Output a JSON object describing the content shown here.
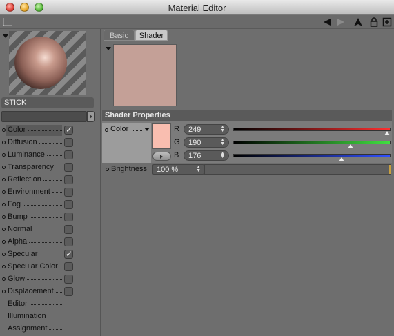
{
  "window": {
    "title": "Material Editor"
  },
  "toolbar": {
    "icons": [
      "back-arrow-icon",
      "forward-arrow-icon",
      "up-arrow-icon",
      "lock-icon",
      "new-window-icon"
    ]
  },
  "material": {
    "name": "STICK",
    "name_field_value": ""
  },
  "channels": [
    {
      "label": "Color",
      "checked": true,
      "selected": true,
      "has_bullet": true,
      "has_checkbox": true
    },
    {
      "label": "Diffusion",
      "checked": false,
      "selected": false,
      "has_bullet": true,
      "has_checkbox": true
    },
    {
      "label": "Luminance",
      "checked": false,
      "selected": false,
      "has_bullet": true,
      "has_checkbox": true
    },
    {
      "label": "Transparency",
      "checked": false,
      "selected": false,
      "has_bullet": true,
      "has_checkbox": true
    },
    {
      "label": "Reflection",
      "checked": false,
      "selected": false,
      "has_bullet": true,
      "has_checkbox": true
    },
    {
      "label": "Environment",
      "checked": false,
      "selected": false,
      "has_bullet": true,
      "has_checkbox": true
    },
    {
      "label": "Fog",
      "checked": false,
      "selected": false,
      "has_bullet": true,
      "has_checkbox": true
    },
    {
      "label": "Bump",
      "checked": false,
      "selected": false,
      "has_bullet": true,
      "has_checkbox": true
    },
    {
      "label": "Normal",
      "checked": false,
      "selected": false,
      "has_bullet": true,
      "has_checkbox": true
    },
    {
      "label": "Alpha",
      "checked": false,
      "selected": false,
      "has_bullet": true,
      "has_checkbox": true
    },
    {
      "label": "Specular",
      "checked": true,
      "selected": false,
      "has_bullet": true,
      "has_checkbox": true
    },
    {
      "label": "Specular Color",
      "checked": false,
      "selected": false,
      "has_bullet": true,
      "has_checkbox": true
    },
    {
      "label": "Glow",
      "checked": false,
      "selected": false,
      "has_bullet": true,
      "has_checkbox": true
    },
    {
      "label": "Displacement",
      "checked": false,
      "selected": false,
      "has_bullet": true,
      "has_checkbox": true
    },
    {
      "label": "Editor",
      "checked": false,
      "selected": false,
      "has_bullet": false,
      "has_checkbox": false
    },
    {
      "label": "Illumination",
      "checked": false,
      "selected": false,
      "has_bullet": false,
      "has_checkbox": false
    },
    {
      "label": "Assignment",
      "checked": false,
      "selected": false,
      "has_bullet": false,
      "has_checkbox": false
    }
  ],
  "tabs": {
    "basic": "Basic",
    "shader": "Shader",
    "active": "Shader"
  },
  "shader_properties": {
    "header": "Shader Properties",
    "color_label": "Color",
    "swatch_color": "#f9beb0",
    "r": {
      "label": "R",
      "value": "249",
      "fraction": 0.976
    },
    "g": {
      "label": "G",
      "value": "190",
      "fraction": 0.745
    },
    "b": {
      "label": "B",
      "value": "176",
      "fraction": 0.69
    },
    "brightness_label": "Brightness",
    "brightness_value": "100 %"
  },
  "colors": {
    "preview_tint": "#c4a097",
    "slider_r": "#ff3030",
    "slider_g": "#40e040",
    "slider_b": "#3050ff"
  }
}
